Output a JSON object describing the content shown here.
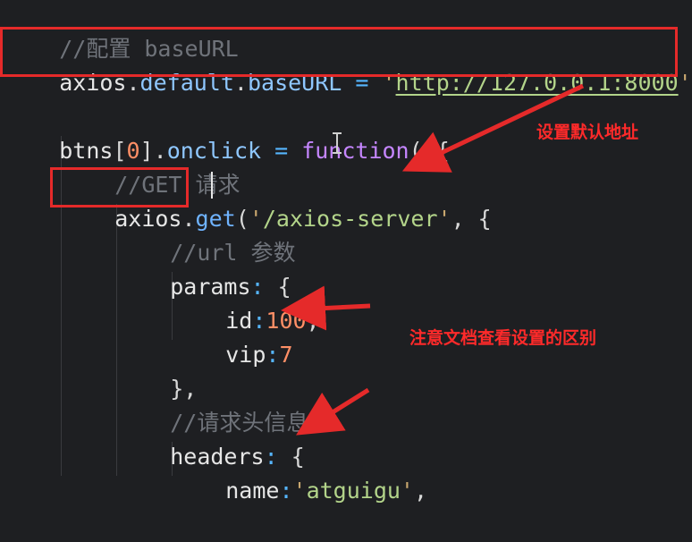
{
  "code": {
    "line1": {
      "comment": "//配置 baseURL"
    },
    "line2": {
      "obj": "axios",
      "dot1": ".",
      "prop1": "default",
      "dot2": ".",
      "prop2": "baseURL",
      "eq": " = ",
      "q1": "'",
      "url": "http://127.0.0.1:8000",
      "q2": "'",
      "semi": ";"
    },
    "line4": {
      "obj": "btns",
      "br": "[",
      "idx": "0",
      "br2": "]",
      "dot": ".",
      "prop": "onclick",
      "eq": " = ",
      "kw": "function",
      "tail": "(){"
    },
    "line5": {
      "comment": "//GET 请求"
    },
    "line6": {
      "obj": "axios",
      "dot": ".",
      "fn": "get",
      "paren": "(",
      "q1": "'",
      "path": "/axios-server",
      "q2": "'",
      "tail": ", {"
    },
    "line7": {
      "comment": "//url 参数"
    },
    "line8": {
      "key": "params",
      "colon": ": ",
      "brace": "{"
    },
    "line9": {
      "key": "id",
      "colon": ":",
      "num": "100",
      "comma": ","
    },
    "line10": {
      "key": "vip",
      "colon": ":",
      "num": "7"
    },
    "line11": {
      "text": "},"
    },
    "line12": {
      "comment": "//请求头信息"
    },
    "line13": {
      "key": "headers",
      "colon": ": ",
      "brace": "{"
    },
    "line14": {
      "key": "name",
      "colon": ":",
      "q1": "'",
      "val": "atguigu",
      "q2": "'",
      "comma": ","
    }
  },
  "annotations": {
    "default_address": "设置默认地址",
    "doc_difference": "注意文档查看设置的区别"
  },
  "colors": {
    "background": "#1e1f22",
    "highlight_red": "#e52a2a",
    "annotation_text": "#ff2a2a"
  }
}
